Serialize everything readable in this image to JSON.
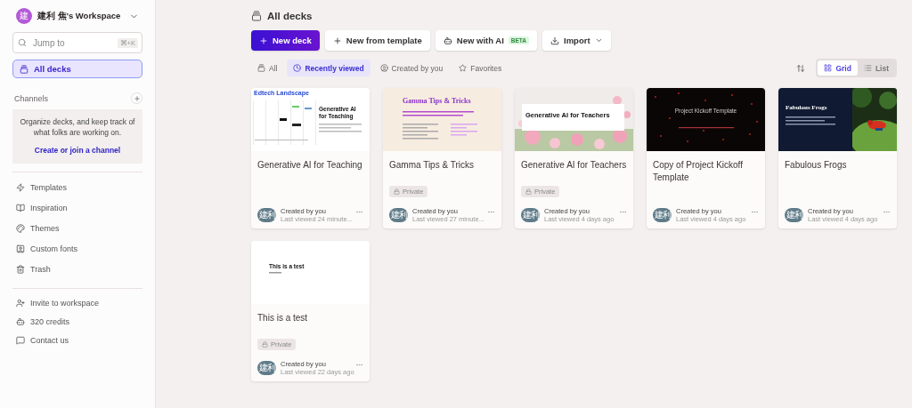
{
  "workspace": {
    "avatar": "建",
    "name": "建利 焦's Workspace"
  },
  "search": {
    "placeholder": "Jump to",
    "shortcut": "⌘+K"
  },
  "primary_nav": [
    {
      "label": "All decks",
      "selected": true
    }
  ],
  "channels": {
    "title": "Channels",
    "empty_text": "Organize decks, and keep track of what folks are working on.",
    "link": "Create or join a channel"
  },
  "nav_items": [
    {
      "label": "Templates"
    },
    {
      "label": "Inspiration"
    },
    {
      "label": "Themes"
    },
    {
      "label": "Custom fonts"
    },
    {
      "label": "Trash"
    }
  ],
  "footer_items": [
    {
      "label": "Invite to workspace"
    },
    {
      "label": "320 credits"
    },
    {
      "label": "Contact us"
    }
  ],
  "page_title": "All decks",
  "actions": [
    {
      "kind": "primary",
      "label": "New deck"
    },
    {
      "kind": "template",
      "label": "New from template"
    },
    {
      "kind": "ai",
      "label": "New with AI",
      "badge": "BETA"
    },
    {
      "kind": "import",
      "label": "Import"
    }
  ],
  "filters": [
    {
      "label": "All",
      "selected": false
    },
    {
      "label": "Recently viewed",
      "selected": true
    },
    {
      "label": "Created by you",
      "selected": false
    },
    {
      "label": "Favorites",
      "selected": false
    }
  ],
  "view_toggle": [
    {
      "label": "Grid",
      "selected": true
    },
    {
      "label": "List",
      "selected": false
    }
  ],
  "decks": [
    {
      "title": "Generative AI for Teaching",
      "thumb": {
        "kind": "landscape",
        "heading": "Edtech Landscape",
        "title": "Generative AI for Teaching"
      },
      "created": "Created by you",
      "viewed": "Last viewed 24 minute...",
      "avatar": "建利"
    },
    {
      "title": "Gamma Tips & Tricks",
      "thumb": {
        "kind": "tips",
        "title": "Gamma Tips & Tricks"
      },
      "badge": "Private",
      "created": "Created by you",
      "viewed": "Last viewed 27 minute...",
      "avatar": "建利"
    },
    {
      "title": "Generative AI for Teachers",
      "thumb": {
        "kind": "flowers",
        "title": "Generative AI for Teachers"
      },
      "badge": "Private",
      "created": "Created by you",
      "viewed": "Last viewed 4 days ago",
      "avatar": "建利"
    },
    {
      "title": "Copy of Project Kickoff Template",
      "thumb": {
        "kind": "dark",
        "title": "Project Kickoff Template"
      },
      "created": "Created by you",
      "viewed": "Last viewed 4 days ago",
      "avatar": "建利"
    },
    {
      "title": "Fabulous Frogs",
      "thumb": {
        "kind": "frogs",
        "title": "Fabulous Frogs"
      },
      "created": "Created by you",
      "viewed": "Last viewed 4 days ago",
      "avatar": "建利"
    },
    {
      "title": "This is a test",
      "thumb": {
        "kind": "plain",
        "title": "This is a test"
      },
      "badge": "Private",
      "created": "Created by you",
      "viewed": "Last viewed 22 days ago",
      "avatar": "建利"
    }
  ]
}
